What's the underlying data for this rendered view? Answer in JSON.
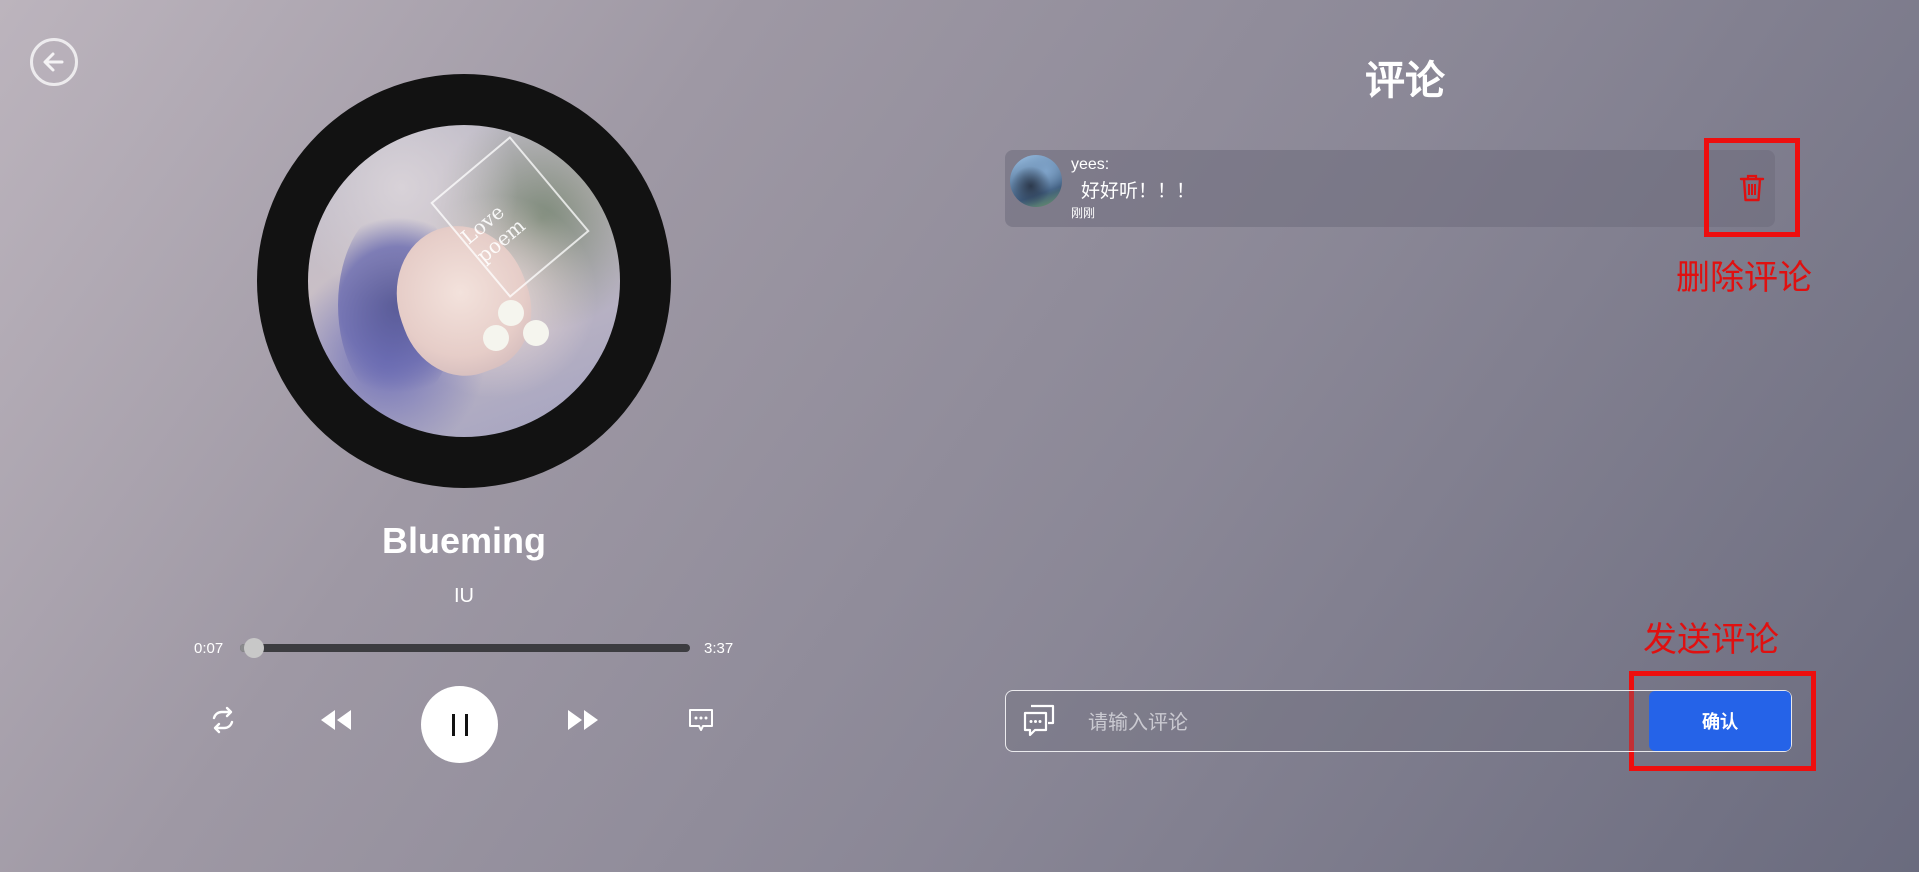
{
  "player": {
    "song_title": "Blueming",
    "artist": "IU",
    "current_time": "0:07",
    "duration": "3:37",
    "progress": 0.032,
    "state": "playing",
    "cover_text": "Love poem"
  },
  "controls": {
    "repeat_icon": "repeat-icon",
    "prev_icon": "rewind-icon",
    "play_pause_icon": "pause-icon",
    "next_icon": "fast-forward-icon",
    "comments_icon": "comment-icon"
  },
  "comments": {
    "title": "评论",
    "items": [
      {
        "user": "yees:",
        "text": "好好听！！！",
        "time": "刚刚"
      }
    ],
    "input_placeholder": "请输入评论",
    "input_value": "",
    "confirm_label": "确认"
  },
  "annotations": {
    "delete_label": "删除评论",
    "send_label": "发送评论",
    "color": "#ee0e0e"
  },
  "colors": {
    "confirm_button": "#2563e8",
    "record": "#121212"
  }
}
